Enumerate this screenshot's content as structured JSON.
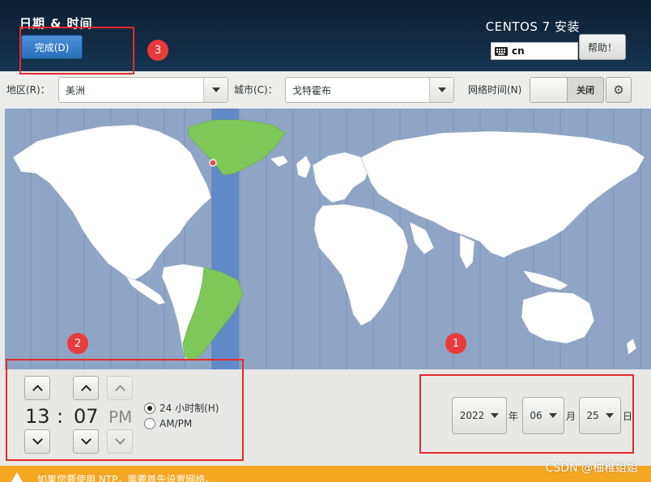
{
  "header": {
    "title": "日期 & 时间",
    "done_label": "完成(D)",
    "install_title": "CENTOS 7 安装",
    "keyboard_layout": "cn",
    "help_label": "帮助！"
  },
  "toolbar": {
    "region_label": "地区(R)：",
    "region_value": "美洲",
    "city_label": "城市(C)：",
    "city_value": "戈特霍布",
    "ntp_label": "网络时间(N)",
    "ntp_state": "关闭"
  },
  "map": {
    "selected_zone_color": "#7ec85a",
    "ocean_color": "#8fa5c6",
    "land_color": "#ffffff",
    "highlight_band_color": "#6289c7"
  },
  "time": {
    "hours": "13",
    "separator": ":",
    "minutes": "07",
    "ampm": "PM",
    "format_24h_label": "24 小时制(H)",
    "format_ampm_label": "AM/PM",
    "selected_format": "24h"
  },
  "date": {
    "year": "2022",
    "year_suffix": "年",
    "month": "06",
    "month_suffix": "月",
    "day": "25",
    "day_suffix": "日"
  },
  "warning": {
    "text": "如果您要使用 NTP，需要首先设置网络。"
  },
  "watermark": "CSDN @柚稚姐姐",
  "annotations": {
    "marker_1": "1",
    "marker_2": "2",
    "marker_3": "3",
    "color": "#e52a2a"
  }
}
